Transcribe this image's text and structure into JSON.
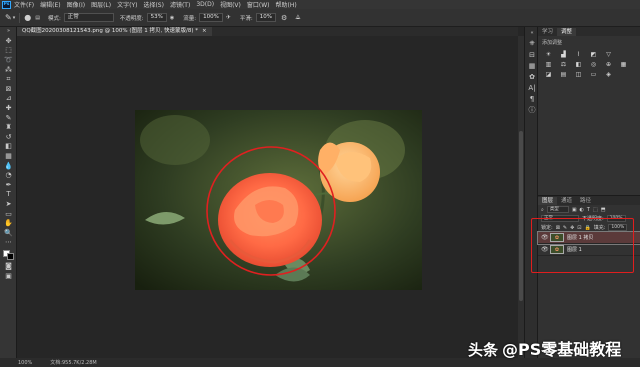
{
  "app": {
    "logo": "Ps"
  },
  "menu": [
    "文件(F)",
    "编辑(E)",
    "图像(I)",
    "图层(L)",
    "文字(Y)",
    "选择(S)",
    "滤镜(T)",
    "3D(D)",
    "视图(V)",
    "窗口(W)",
    "帮助(H)"
  ],
  "options": {
    "mode_label": "模式:",
    "mode_value": "正常",
    "opacity_label": "不透明度:",
    "opacity_value": "53%",
    "flow_label": "流量:",
    "flow_value": "100%",
    "smooth_label": "平滑:",
    "smooth_value": "10%"
  },
  "tab": {
    "title": "QQ截图20200308121543.png @ 100% (图层 1 拷贝, 快速蒙版/8) *",
    "close": "×"
  },
  "adjustments": {
    "tab1": "学习",
    "tab2": "调整",
    "title": "添加调整"
  },
  "layers": {
    "tabs": [
      "图层",
      "通道",
      "路径"
    ],
    "kind_label": "类型",
    "blend_value": "正常",
    "opacity_label": "不透明度:",
    "opacity_value": "100%",
    "lock_label": "锁定:",
    "fill_label": "填充:",
    "fill_value": "100%",
    "items": [
      {
        "name": "图层 1 拷贝",
        "selected": true
      },
      {
        "name": "图层 1",
        "selected": false
      }
    ]
  },
  "status": {
    "zoom": "100%",
    "doc": "文档:955.7K/2.28M"
  },
  "watermark": {
    "prefix": "头条",
    "text": "@PS零基础教程"
  },
  "colors": {
    "accent": "#31a8ff",
    "highlight": "#e01e1e"
  }
}
